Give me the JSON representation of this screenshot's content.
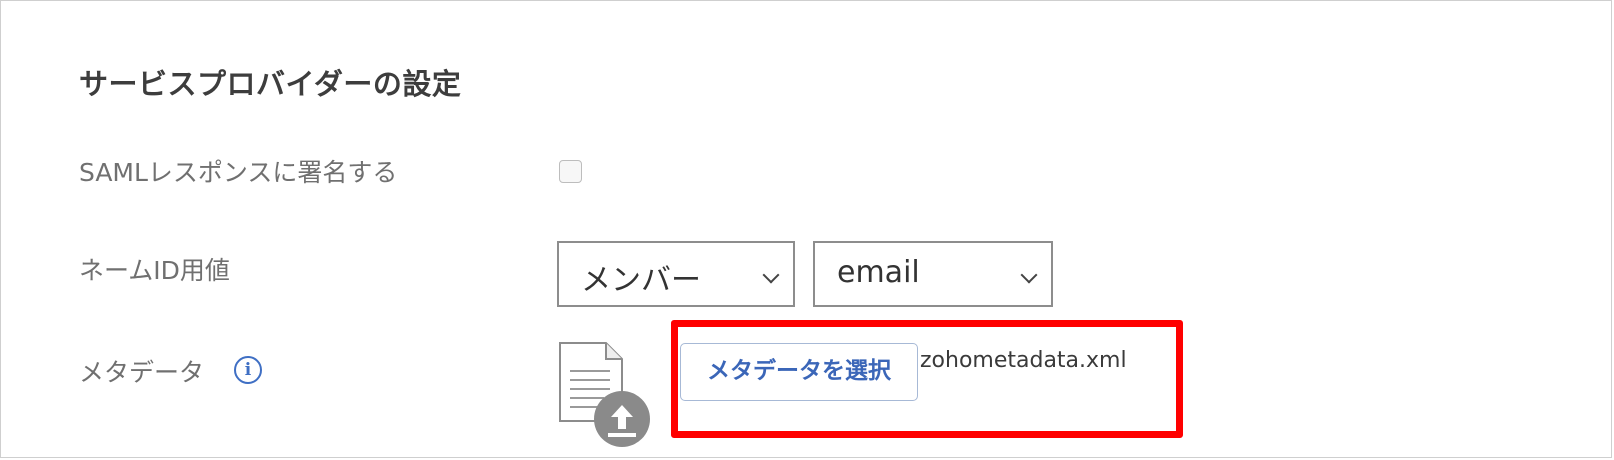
{
  "section": {
    "title": "サービスプロバイダーの設定"
  },
  "fields": {
    "sign_response": {
      "label": "SAMLレスポンスに署名する",
      "checked": false
    },
    "name_id": {
      "label": "ネームID用値",
      "select1": "メンバー",
      "select2": "email"
    },
    "metadata": {
      "label": "メタデータ",
      "info_icon": "info-icon",
      "file_icon": "file-upload-icon",
      "choose_button": "メタデータを選択",
      "filename": "zohometadata.xml"
    }
  },
  "colors": {
    "accent": "#3b66b8",
    "highlight": "#ff0000",
    "label": "#707070"
  }
}
